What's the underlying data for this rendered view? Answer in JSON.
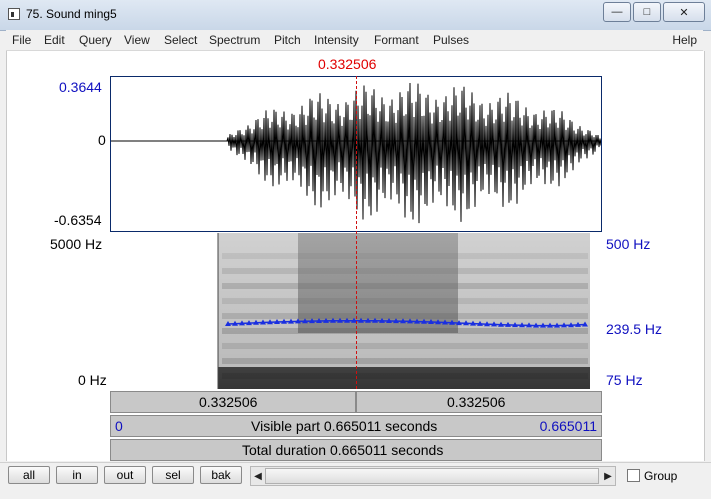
{
  "window": {
    "title": "75. Sound ming5"
  },
  "menu": [
    "File",
    "Edit",
    "Query",
    "View",
    "Select",
    "Spectrum",
    "Pitch",
    "Intensity",
    "Formant",
    "Pulses"
  ],
  "menu_help": "Help",
  "cursor": {
    "time_label": "0.332506"
  },
  "waveform": {
    "ymax_label": "0.3644",
    "zero_label": "0",
    "ymin_label": "-0.6354"
  },
  "spectrogram": {
    "top_label": "5000 Hz",
    "bottom_label": "0 Hz",
    "pitch_top": "500 Hz",
    "pitch_mid": "239.5 Hz",
    "pitch_bottom": "75 Hz"
  },
  "bars": {
    "left_time": "0.332506",
    "right_time": "0.332506",
    "visible_start": "0",
    "visible_text": "Visible part 0.665011 seconds",
    "visible_end": "0.665011",
    "total_text": "Total duration 0.665011 seconds"
  },
  "buttons": {
    "all": "all",
    "in": "in",
    "out": "out",
    "sel": "sel",
    "bak": "bak"
  },
  "group": {
    "label": "Group",
    "checked": false
  },
  "colors": {
    "pitch": "#1a2fe0",
    "cursor": "#e00000",
    "axis_blue": "#1010c0"
  }
}
